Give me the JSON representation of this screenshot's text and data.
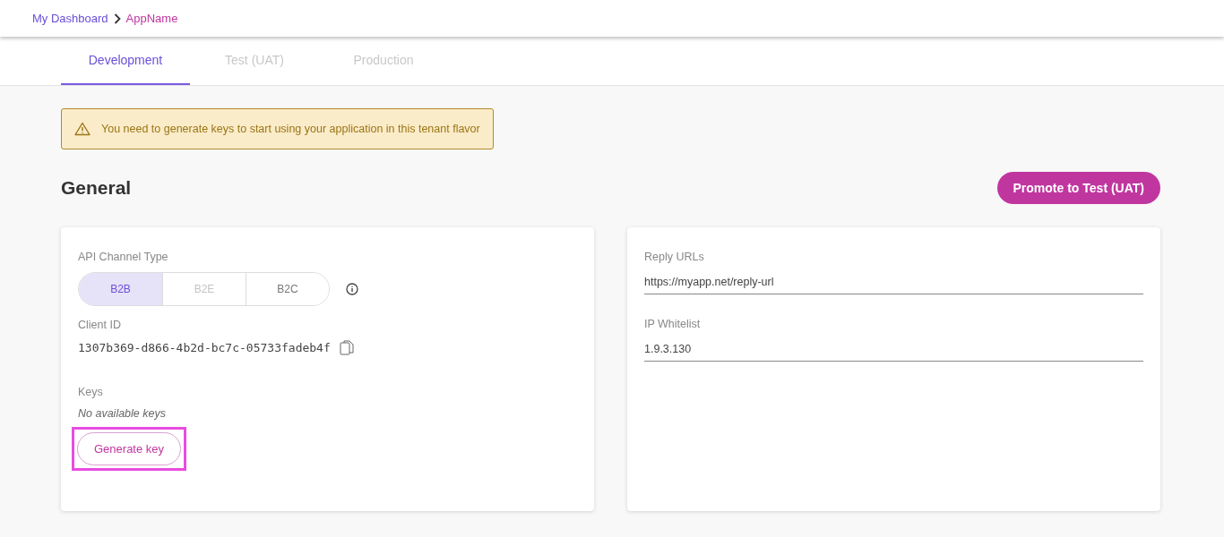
{
  "breadcrumb": [
    {
      "label": "My Dashboard",
      "current": false
    },
    {
      "label": "AppName",
      "current": true
    }
  ],
  "tabs": [
    {
      "label": "Development",
      "selected": true,
      "disabled": false
    },
    {
      "label": "Test (UAT)",
      "selected": false,
      "disabled": true
    },
    {
      "label": "Production",
      "selected": false,
      "disabled": true
    }
  ],
  "alert": {
    "text": "You need to generate keys to start using your application in this tenant flavor"
  },
  "section": {
    "title": "General",
    "action": "Promote to Test (UAT)"
  },
  "left_card": {
    "channel_label": "API Channel Type",
    "channels": [
      {
        "label": "B2B",
        "selected": true,
        "disabled": false
      },
      {
        "label": "B2E",
        "selected": false,
        "disabled": true
      },
      {
        "label": "B2C",
        "selected": false,
        "disabled": false
      }
    ],
    "client_id_label": "Client ID",
    "client_id": "1307b369-d866-4b2d-bc7c-05733fadeb4f",
    "keys_label": "Keys",
    "keys_empty": "No available keys",
    "generate_button": {
      "label": "Generate key",
      "highlighted": true
    }
  },
  "right_card": {
    "fields": [
      {
        "label": "Reply URLs",
        "value": "https://myapp.net/reply-url"
      },
      {
        "label": "IP Whitelist",
        "value": "1.9.3.130"
      }
    ]
  }
}
